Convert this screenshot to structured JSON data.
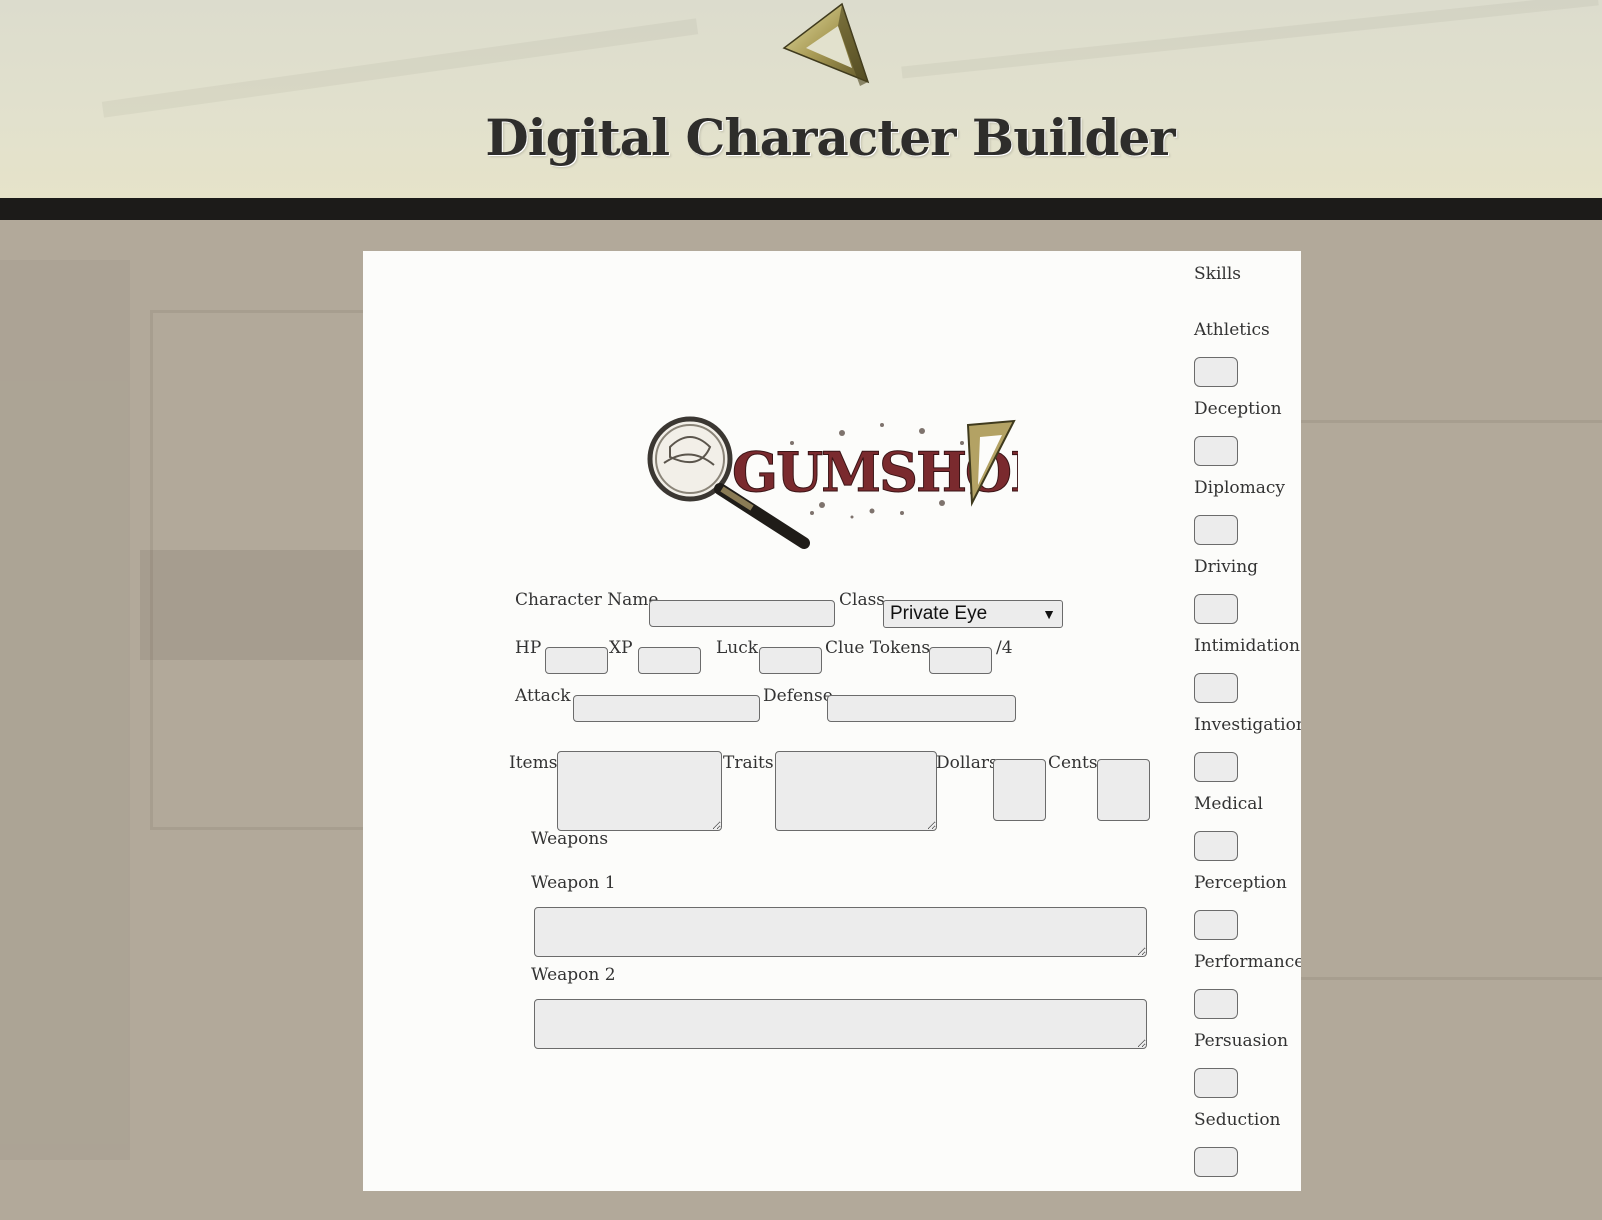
{
  "header": {
    "title": "Digital Character Builder"
  },
  "logo": {
    "text": "GUMSHOE"
  },
  "character": {
    "name_label": "Character Name",
    "name_value": "",
    "class_label": "Class",
    "class_selected": "Private Eye",
    "hp_label": "HP",
    "xp_label": "XP",
    "luck_label": "Luck",
    "clue_tokens_label": "Clue Tokens",
    "clue_tokens_max": "/4",
    "attack_label": "Attack",
    "defense_label": "Defense",
    "items_label": "Items",
    "traits_label": "Traits",
    "dollars_label": "Dollars",
    "cents_label": "Cents"
  },
  "weapons": {
    "section_label": "Weapons",
    "weapon1_label": "Weapon 1",
    "weapon2_label": "Weapon 2"
  },
  "skills": {
    "title": "Skills",
    "items": [
      {
        "label": "Athletics"
      },
      {
        "label": "Deception"
      },
      {
        "label": "Diplomacy"
      },
      {
        "label": "Driving"
      },
      {
        "label": "Intimidation"
      },
      {
        "label": "Investigation"
      },
      {
        "label": "Medical"
      },
      {
        "label": "Perception"
      },
      {
        "label": "Performance"
      },
      {
        "label": "Persuasion"
      },
      {
        "label": "Seduction"
      }
    ]
  },
  "colors": {
    "page_background": "#b2a99a",
    "card_background": "#fcfcfa",
    "logo_red": "#7a2a2e",
    "field_background": "#ececec"
  }
}
